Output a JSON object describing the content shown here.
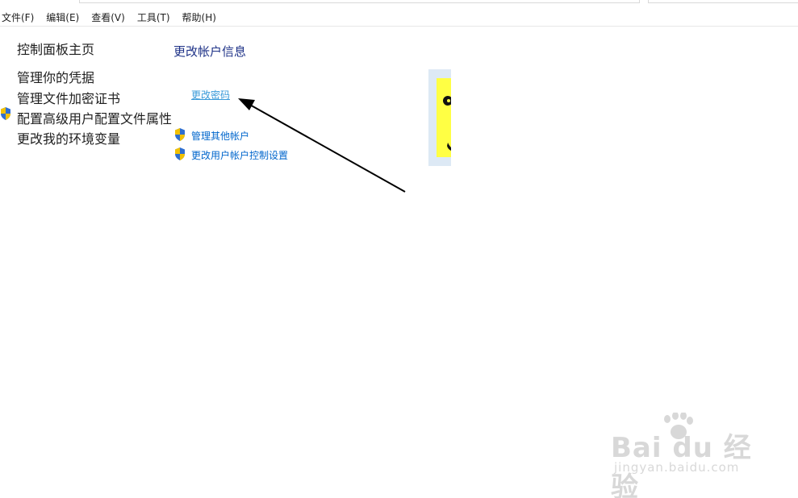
{
  "menubar": {
    "items": [
      {
        "label": "文件(F)"
      },
      {
        "label": "编辑(E)"
      },
      {
        "label": "查看(V)"
      },
      {
        "label": "工具(T)"
      },
      {
        "label": "帮助(H)"
      }
    ]
  },
  "sidebar": {
    "home_label": "控制面板主页",
    "items": [
      {
        "label": "管理你的凭据",
        "shield": false
      },
      {
        "label": "管理文件加密证书",
        "shield": false
      },
      {
        "label": "配置高级用户配置文件属性",
        "shield": true
      },
      {
        "label": "更改我的环境变量",
        "shield": false
      }
    ]
  },
  "main": {
    "title": "更改帐户信息",
    "change_password": "更改密码",
    "links": [
      {
        "label": "管理其他帐户",
        "shield": true
      },
      {
        "label": "更改用户帐户控制设置",
        "shield": true
      }
    ]
  },
  "watermark": {
    "logo_text": "Bai du 经验",
    "sub_text": "jingyan.baidu.com"
  },
  "colors": {
    "title": "#1e3287",
    "link": "#0066cc",
    "hover_link": "#3a9ad9",
    "avatar_bg": "#ffff44",
    "avatar_frame": "#dde9f5"
  }
}
